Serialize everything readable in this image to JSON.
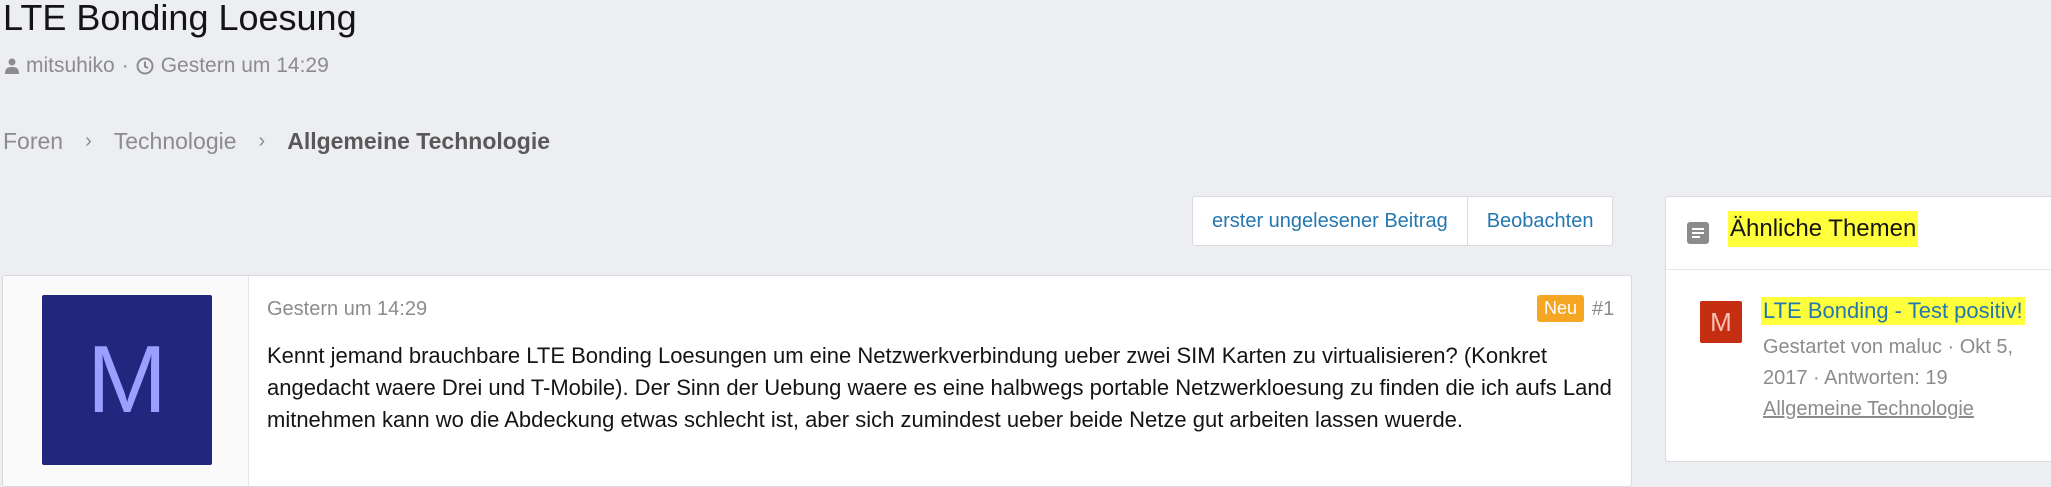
{
  "thread": {
    "title": "LTE Bonding Loesung",
    "author": "mitsuhiko",
    "meta_sep": "·",
    "date": "Gestern um 14:29"
  },
  "breadcrumbs": {
    "items": [
      "Foren",
      "Technologie",
      "Allgemeine Technologie"
    ],
    "separator": "›"
  },
  "actions": {
    "first_unread": "erster ungelesener Beitrag",
    "watch": "Beobachten"
  },
  "post": {
    "avatar_letter": "M",
    "date": "Gestern um 14:29",
    "badge": "Neu",
    "number": "#1",
    "body": "Kennt jemand brauchbare LTE Bonding Loesungen um eine Netzwerkverbindung ueber zwei SIM Karten zu virtualisieren? (Konkret angedacht waere Drei und T-Mobile). Der Sinn der Uebung waere es eine halbwegs portable Netzwerkloesung zu finden die ich aufs Land mitnehmen kann wo die Abdeckung etwas schlecht ist, aber sich zumindest ueber beide Netze gut arbeiten lassen wuerde."
  },
  "sidebar": {
    "title": "Ähnliche Themen",
    "threads": [
      {
        "avatar_letter": "M",
        "title": "LTE Bonding - Test positiv!",
        "info": "Gestartet von maluc · Okt 5, 2017 · Antworten: 19",
        "forum": "Allgemeine Technologie"
      }
    ]
  },
  "colors": {
    "link": "#2577b1",
    "badge": "#f5a623",
    "highlight": "#ffff3b",
    "avatar_main": "#22267c",
    "avatar_small": "#c62e12"
  },
  "icons": [
    "user-icon",
    "clock-icon",
    "chevron-right-icon",
    "list-icon"
  ]
}
